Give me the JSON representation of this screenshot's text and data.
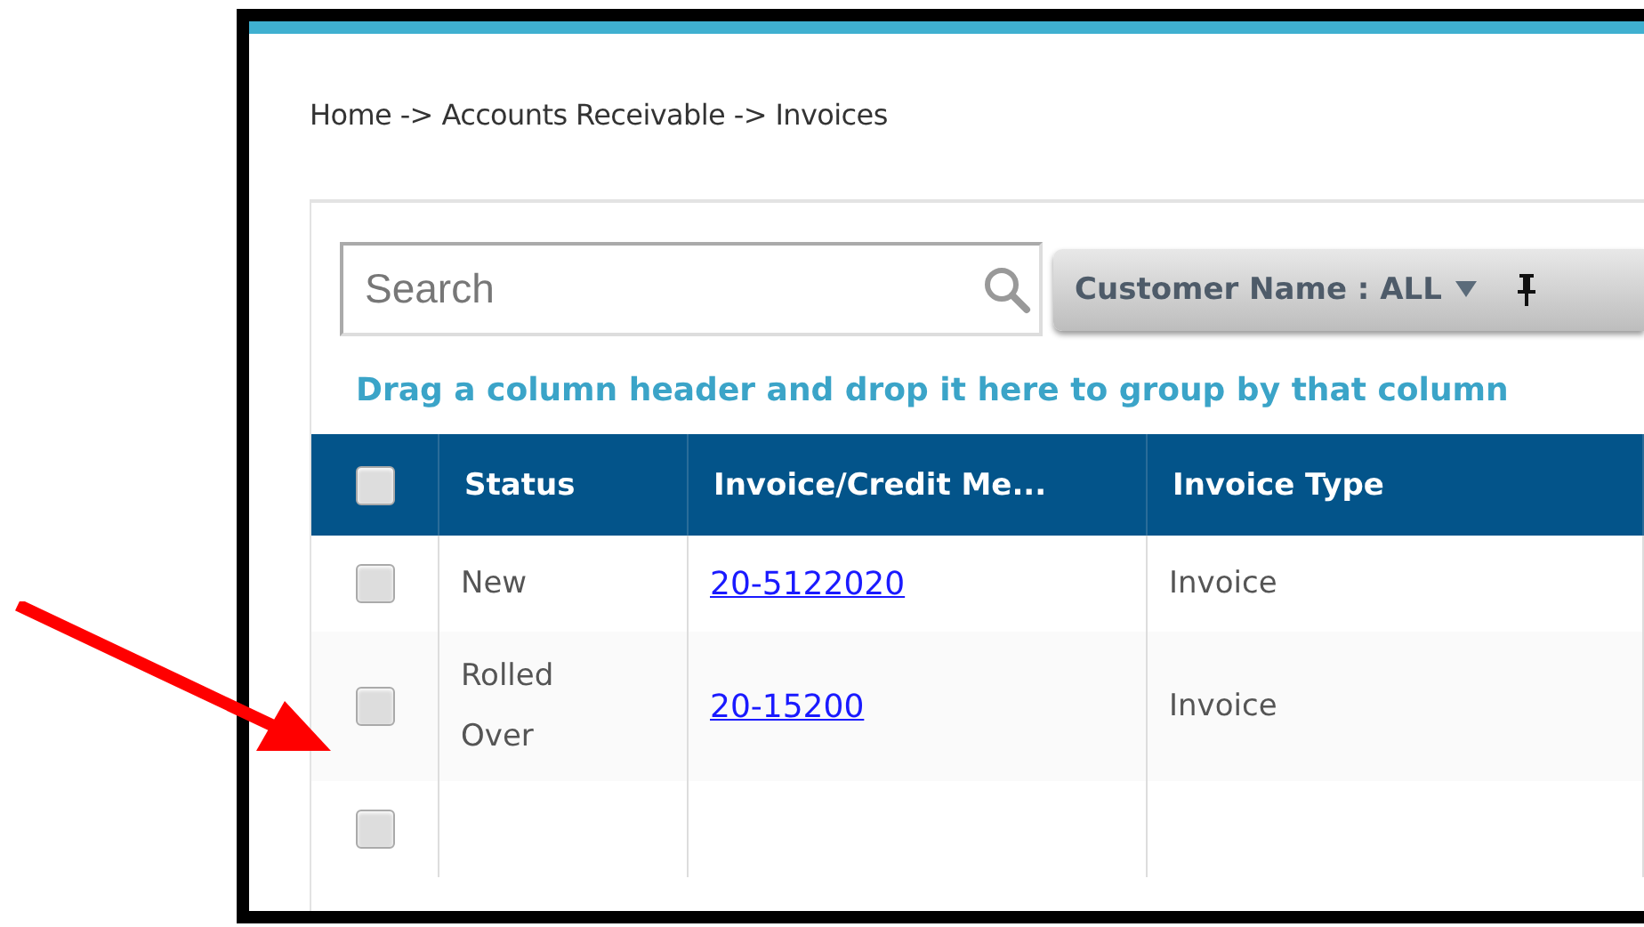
{
  "breadcrumb": "Home -> Accounts Receivable -> Invoices",
  "search": {
    "placeholder": "Search"
  },
  "filter": {
    "label": "Customer Name : ALL"
  },
  "group_hint": "Drag a column header and drop it here to group by that column",
  "table": {
    "select_all": {
      "checked": false
    },
    "columns": [
      "Status",
      "Invoice/Credit Me...",
      "Invoice Type"
    ],
    "rows": [
      {
        "checked": false,
        "status": "New",
        "number": "20-5122020",
        "type": "Invoice"
      },
      {
        "checked": false,
        "status": "Rolled Over",
        "number": "20-15200",
        "type": "Invoice"
      },
      {
        "checked": false
      }
    ]
  }
}
